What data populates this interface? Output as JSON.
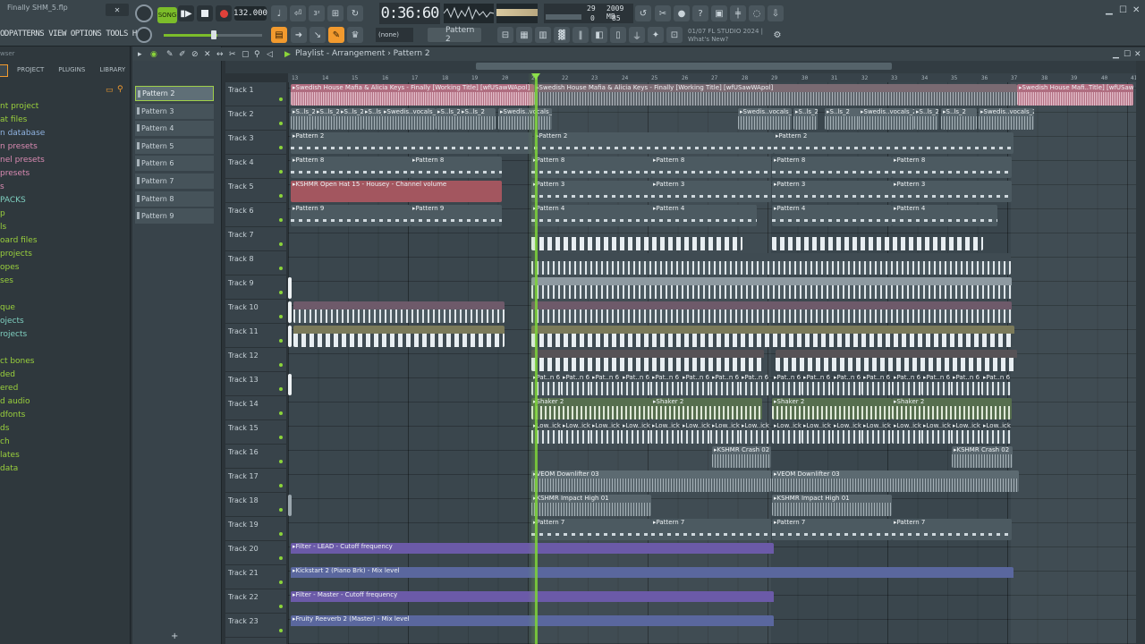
{
  "window": {
    "title": "Finally SHM_5.flp",
    "minimize": "▁",
    "maximize": "☐",
    "close": "✕"
  },
  "menu": [
    "ODPATTERNS",
    "VIEW",
    "OPTIONS",
    "TOOLS",
    "HELP"
  ],
  "transport": {
    "song_mode": "SONG",
    "tempo": "132.000",
    "time": "0:36:60",
    "cpu_a": "29",
    "mem": "2009 MB",
    "cpu_b": "85",
    "cpu_c": "0"
  },
  "toolbar": {
    "snap": "(none)",
    "pattern": "Pattern 2",
    "news_line1": "01/07  FL STUDIO 2024 |",
    "news_line2": "What's New?"
  },
  "browser": {
    "header": "wser",
    "tabs": [
      "",
      "PROJECT",
      "PLUGINS",
      "LIBRARY"
    ],
    "items": [
      {
        "label": "nt project",
        "color": "#9ad03c"
      },
      {
        "label": "at files",
        "color": "#9ad03c"
      },
      {
        "label": "n database",
        "color": "#8fb2e0"
      },
      {
        "label": "n presets",
        "color": "#d98ab2"
      },
      {
        "label": "nel presets",
        "color": "#d98ab2"
      },
      {
        "label": "presets",
        "color": "#d98ab2"
      },
      {
        "label": "s",
        "color": "#d98ab2"
      },
      {
        "label": "PACKS",
        "color": "#7fcfc0"
      },
      {
        "label": "p",
        "color": "#9ad03c"
      },
      {
        "label": "ls",
        "color": "#9ad03c"
      },
      {
        "label": "oard files",
        "color": "#9ad03c"
      },
      {
        "label": "projects",
        "color": "#9ad03c"
      },
      {
        "label": "opes",
        "color": "#9ad03c"
      },
      {
        "label": "ses",
        "color": "#9ad03c"
      },
      {
        "label": "",
        "color": "#9ad03c"
      },
      {
        "label": "que",
        "color": "#9ad03c"
      },
      {
        "label": "ojects",
        "color": "#7fcfc0"
      },
      {
        "label": "rojects",
        "color": "#7fcfc0"
      },
      {
        "label": "",
        "color": "#9ad03c"
      },
      {
        "label": "ct bones",
        "color": "#9ad03c"
      },
      {
        "label": "ded",
        "color": "#9ad03c"
      },
      {
        "label": "ered",
        "color": "#9ad03c"
      },
      {
        "label": "d audio",
        "color": "#9ad03c"
      },
      {
        "label": "dfonts",
        "color": "#9ad03c"
      },
      {
        "label": "ds",
        "color": "#9ad03c"
      },
      {
        "label": "ch",
        "color": "#9ad03c"
      },
      {
        "label": "lates",
        "color": "#9ad03c"
      },
      {
        "label": "data",
        "color": "#9ad03c"
      }
    ]
  },
  "picker": {
    "patterns": [
      "Pattern 2",
      "Pattern 3",
      "Pattern 4",
      "Pattern 5",
      "Pattern 6",
      "Pattern 7",
      "Pattern 8",
      "Pattern 9"
    ],
    "selected": "Pattern 2",
    "add": "+"
  },
  "playlist": {
    "title": "Playlist - Arrangement › Pattern 2",
    "ruler": [
      "13",
      "15",
      "17",
      "19",
      "21",
      "23",
      "25",
      "27",
      "29",
      "31",
      "33",
      "35",
      "37",
      "39",
      "41"
    ],
    "ruler_mid": [
      "14",
      "16",
      "18",
      "20",
      "22",
      "24",
      "26",
      "28",
      "30",
      "32",
      "34",
      "36",
      "38",
      "40"
    ],
    "tracks": [
      "Track 1",
      "Track 2",
      "Track 3",
      "Track 4",
      "Track 5",
      "Track 6",
      "Track 7",
      "Track 8",
      "Track 9",
      "Track 10",
      "Track 11",
      "Track 12",
      "Track 13",
      "Track 14",
      "Track 15",
      "Track 16",
      "Track 17",
      "Track 18",
      "Track 19",
      "Track 20",
      "Track 21",
      "Track 22",
      "Track 23"
    ],
    "clips": {
      "t1_a": "Swedish House Mafia & Alicia Keys - Finally [Working Title] [wfUSawWApol]",
      "t1_b": "Swedish House Mafia & Alicia Keys - Finally [Working Title] [wfUSawWApol]",
      "t1_c": "Swedish House Mafi..Title] [wfUSawWApol]",
      "t2_s": "S..ls_2",
      "t2_v": "Swedis..vocals_2",
      "pattern2": "Pattern 2",
      "pattern8": "Pattern 8",
      "pattern3": "Pattern 3",
      "pattern9": "Pattern 9",
      "pattern4": "Pattern 4",
      "pattern7": "Pattern 7",
      "t5_auto": "KSHMR Open Hat 15 - Housey - Channel volume",
      "pat_n6": "Pat..n 6",
      "shaker": "Shaker 2",
      "lowkick": "Low..ick",
      "crash": "KSHMR Crash 02",
      "downlifter": "VEOM Downlifter 03",
      "impact": "KSHMR Impact High 01",
      "t20": "Filter - LEAD - Cutoff frequency",
      "t21": "Kickstart 2 (Piano Brk) - Mix level",
      "t22": "Filter - Master - Cutoff frequency",
      "t23": "Fruity Reeverb 2 (Master) - Mix level"
    }
  },
  "colors": {
    "accent_green": "#7cbd2a",
    "audio_pink": "#b06d80",
    "automation_purple": "#6b5aa8",
    "automation_blue": "#5a679e",
    "record_red": "#e0413a"
  }
}
